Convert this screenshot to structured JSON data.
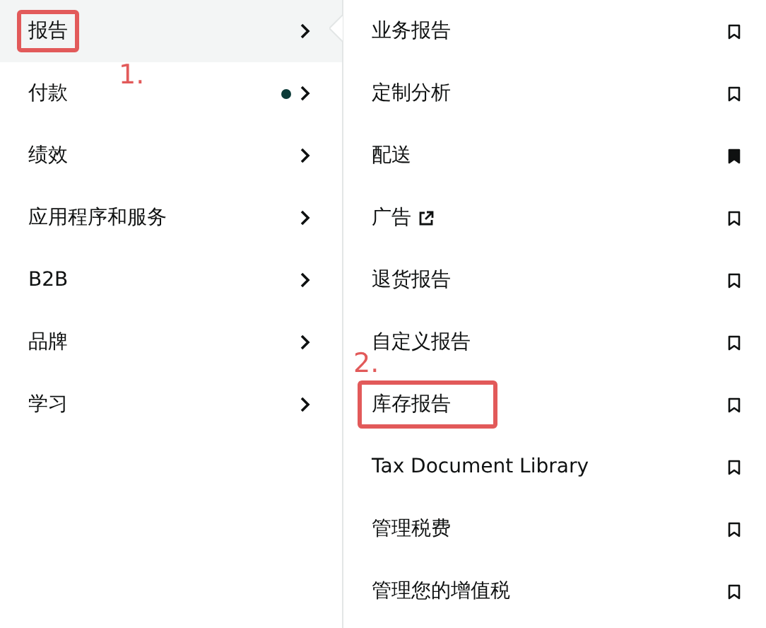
{
  "menu": [
    {
      "label": "报告",
      "selected": true,
      "dot": false,
      "annotation": "1."
    },
    {
      "label": "付款",
      "selected": false,
      "dot": true
    },
    {
      "label": "绩效",
      "selected": false,
      "dot": false
    },
    {
      "label": "应用程序和服务",
      "selected": false,
      "dot": false
    },
    {
      "label": "B2B",
      "selected": false,
      "dot": false
    },
    {
      "label": "品牌",
      "selected": false,
      "dot": false
    },
    {
      "label": "学习",
      "selected": false,
      "dot": false
    }
  ],
  "submenu": [
    {
      "label": "业务报告",
      "bookmarked": false,
      "external": false
    },
    {
      "label": "定制分析",
      "bookmarked": false,
      "external": false
    },
    {
      "label": "配送",
      "bookmarked": true,
      "external": false
    },
    {
      "label": "广告",
      "bookmarked": false,
      "external": true
    },
    {
      "label": "退货报告",
      "bookmarked": false,
      "external": false
    },
    {
      "label": "自定义报告",
      "bookmarked": false,
      "external": false
    },
    {
      "label": "库存报告",
      "bookmarked": false,
      "external": false,
      "annotation": "2."
    },
    {
      "label": "Tax Document Library",
      "bookmarked": false,
      "external": false
    },
    {
      "label": "管理税费",
      "bookmarked": false,
      "external": false
    },
    {
      "label": "管理您的增值税",
      "bookmarked": false,
      "external": false
    }
  ]
}
